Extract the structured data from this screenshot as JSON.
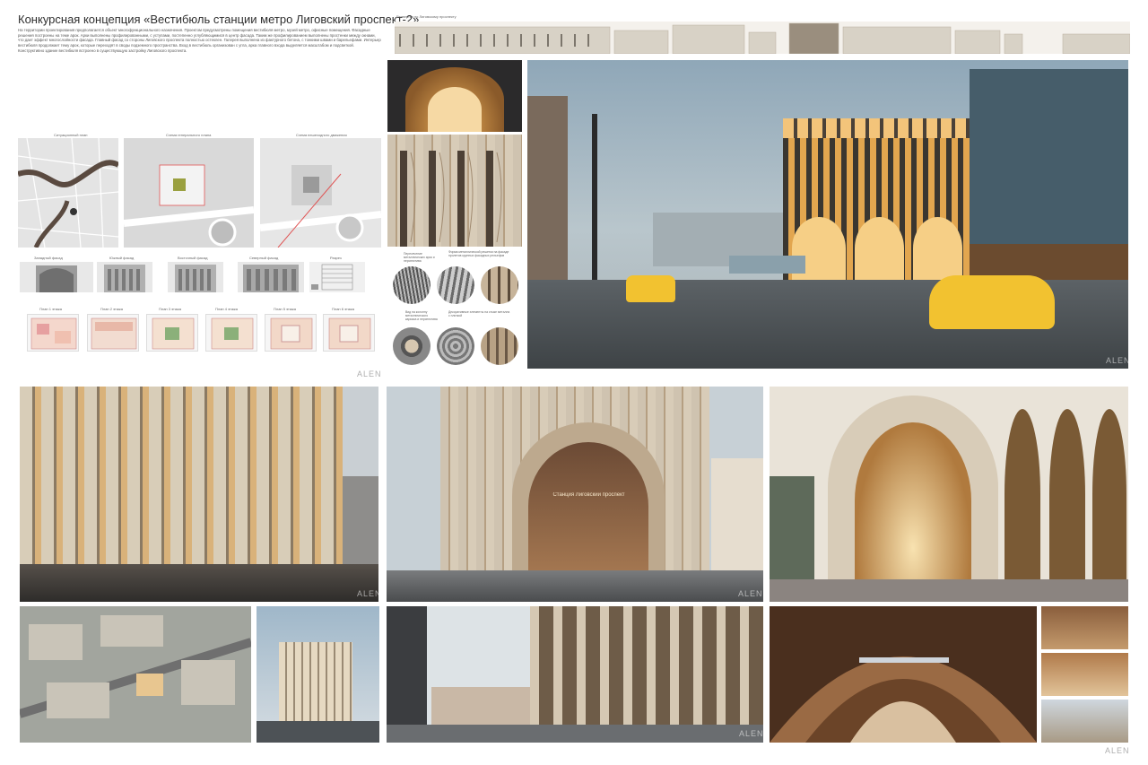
{
  "title": "Конкурсная концепция «Вестибюль станции метро Лиговский проспект-2»",
  "description": "На территории проектирования предполагается объект многофункционального назначения. Проектом предусмотрены помещения вестибюля метро, музей метро, офисные помещения. Фасадные решения построены на теме арок. Арки выполнены профилированными, с уступами, постепенно углубляющимися в центр фасада. Таким же профилированием выполнены простенки между окнами, что дает эффект многослойности фасада. Главный фасад со стороны Лиговского проспекта полностью остеклен. Галерея выполнена из фактурного бетона, с тонкими швами и барельефами. Интерьер вестибюля продолжает тему арок, которые переходят в своды подземного пространства. Вход в вестибюль организован с угла, арка главного входа выделяется масштабом и подсветкой. Конструктивно здание вестибюля встроено в существующую застройку Лиговского проспекта.",
  "site_labels": {
    "situation": "Ситуационный план",
    "scheme": "Схема генерального плана",
    "flows": "Схема пешеходного движения"
  },
  "facade_labels": [
    "Западный фасад",
    "Южный фасад",
    "Восточный фасад",
    "Северный фасад",
    "Разрез"
  ],
  "plan_labels": [
    "План 1 этажа",
    "План 2 этажа",
    "План 3 этажа",
    "План 4 этажа",
    "План 5 этажа",
    "План 6 этажа"
  ],
  "street_panorama_label": "Развертка по Лиговскому проспекту",
  "pattern_labels": [
    "Пересечение металлических арок и перспектива",
    "Форма металлической решетки на фасаде пролетов крупных фасадных рельефов",
    "Вид на колонну металлического каркаса и перспектива",
    "Декоративные элементы на стыке металла с плиткой"
  ],
  "entrance_sign": "Станция Лиговский проспект",
  "watermark": "ALEN",
  "colors": {
    "glow": "#e2a64f",
    "stone": "#cfc3b0",
    "sky": "#b9c6cc",
    "taxi": "#f2c230"
  }
}
